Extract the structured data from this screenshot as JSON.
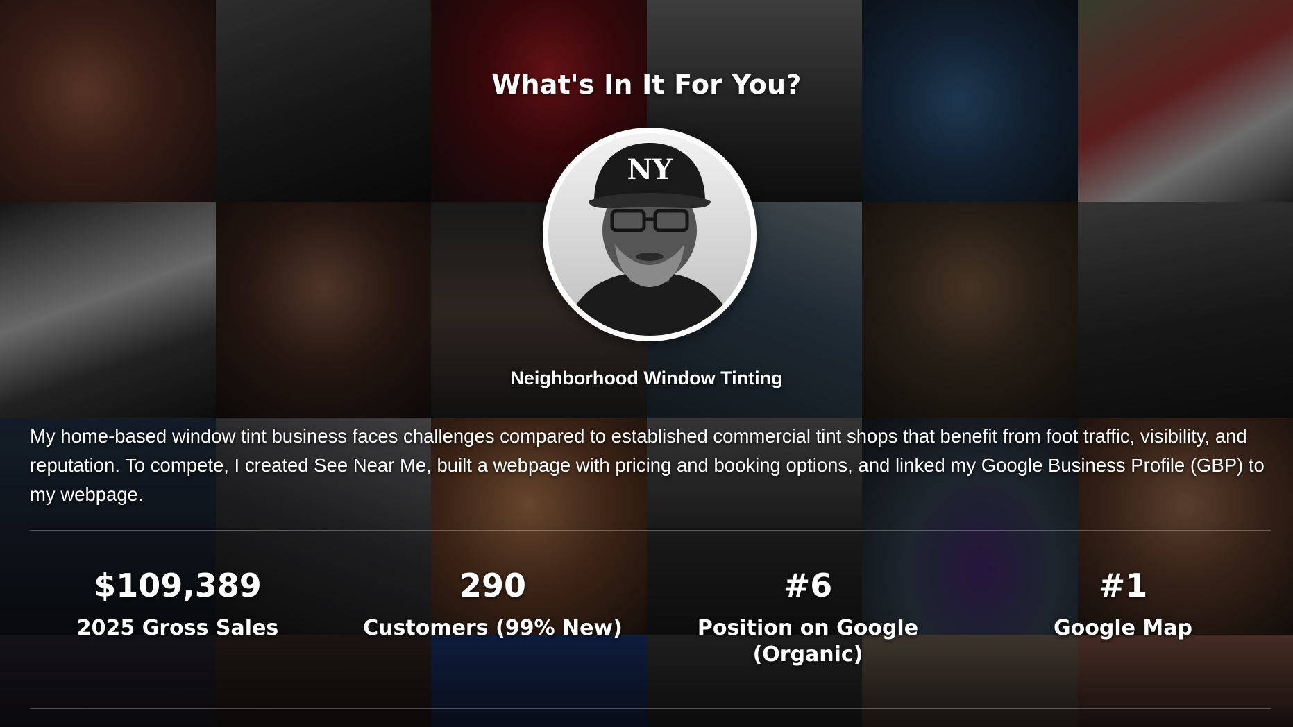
{
  "page": {
    "headline": "What's In It For You?",
    "business_name": "Neighborhood Window Tinting",
    "story": "My home-based window tint business faces challenges compared to established commercial tint shops that benefit from foot traffic, visibility, and reputation. To compete, I created See Near Me, built a webpage with pricing and booking options, and linked my Google Business Profile (GBP) to my webpage."
  },
  "avatar": {
    "cap_logo": "NY"
  },
  "stats": [
    {
      "value": "$109,389",
      "label": "2025 Gross Sales"
    },
    {
      "value": "290",
      "label": "Customers (99% New)"
    },
    {
      "value": "#6",
      "label": "Position on Google (Organic)"
    },
    {
      "value": "#1",
      "label": "Google Map"
    }
  ],
  "colors": {
    "text": "#ffffff",
    "divider": "rgba(255,255,255,0.28)",
    "avatar_ring": "#ffffff"
  }
}
